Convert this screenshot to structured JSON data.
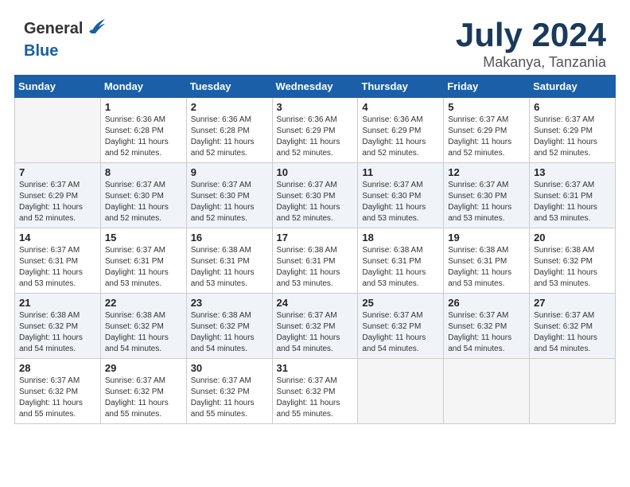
{
  "header": {
    "logo_general": "General",
    "logo_blue": "Blue",
    "title": "July 2024",
    "location": "Makanya, Tanzania"
  },
  "weekdays": [
    "Sunday",
    "Monday",
    "Tuesday",
    "Wednesday",
    "Thursday",
    "Friday",
    "Saturday"
  ],
  "days": [
    {
      "num": "",
      "sunrise": "",
      "sunset": "",
      "daylight": "",
      "empty": true
    },
    {
      "num": "1",
      "sunrise": "Sunrise: 6:36 AM",
      "sunset": "Sunset: 6:28 PM",
      "daylight": "Daylight: 11 hours and 52 minutes."
    },
    {
      "num": "2",
      "sunrise": "Sunrise: 6:36 AM",
      "sunset": "Sunset: 6:28 PM",
      "daylight": "Daylight: 11 hours and 52 minutes."
    },
    {
      "num": "3",
      "sunrise": "Sunrise: 6:36 AM",
      "sunset": "Sunset: 6:29 PM",
      "daylight": "Daylight: 11 hours and 52 minutes."
    },
    {
      "num": "4",
      "sunrise": "Sunrise: 6:36 AM",
      "sunset": "Sunset: 6:29 PM",
      "daylight": "Daylight: 11 hours and 52 minutes."
    },
    {
      "num": "5",
      "sunrise": "Sunrise: 6:37 AM",
      "sunset": "Sunset: 6:29 PM",
      "daylight": "Daylight: 11 hours and 52 minutes."
    },
    {
      "num": "6",
      "sunrise": "Sunrise: 6:37 AM",
      "sunset": "Sunset: 6:29 PM",
      "daylight": "Daylight: 11 hours and 52 minutes."
    },
    {
      "num": "7",
      "sunrise": "Sunrise: 6:37 AM",
      "sunset": "Sunset: 6:29 PM",
      "daylight": "Daylight: 11 hours and 52 minutes."
    },
    {
      "num": "8",
      "sunrise": "Sunrise: 6:37 AM",
      "sunset": "Sunset: 6:30 PM",
      "daylight": "Daylight: 11 hours and 52 minutes."
    },
    {
      "num": "9",
      "sunrise": "Sunrise: 6:37 AM",
      "sunset": "Sunset: 6:30 PM",
      "daylight": "Daylight: 11 hours and 52 minutes."
    },
    {
      "num": "10",
      "sunrise": "Sunrise: 6:37 AM",
      "sunset": "Sunset: 6:30 PM",
      "daylight": "Daylight: 11 hours and 52 minutes."
    },
    {
      "num": "11",
      "sunrise": "Sunrise: 6:37 AM",
      "sunset": "Sunset: 6:30 PM",
      "daylight": "Daylight: 11 hours and 53 minutes."
    },
    {
      "num": "12",
      "sunrise": "Sunrise: 6:37 AM",
      "sunset": "Sunset: 6:30 PM",
      "daylight": "Daylight: 11 hours and 53 minutes."
    },
    {
      "num": "13",
      "sunrise": "Sunrise: 6:37 AM",
      "sunset": "Sunset: 6:31 PM",
      "daylight": "Daylight: 11 hours and 53 minutes."
    },
    {
      "num": "14",
      "sunrise": "Sunrise: 6:37 AM",
      "sunset": "Sunset: 6:31 PM",
      "daylight": "Daylight: 11 hours and 53 minutes."
    },
    {
      "num": "15",
      "sunrise": "Sunrise: 6:37 AM",
      "sunset": "Sunset: 6:31 PM",
      "daylight": "Daylight: 11 hours and 53 minutes."
    },
    {
      "num": "16",
      "sunrise": "Sunrise: 6:38 AM",
      "sunset": "Sunset: 6:31 PM",
      "daylight": "Daylight: 11 hours and 53 minutes."
    },
    {
      "num": "17",
      "sunrise": "Sunrise: 6:38 AM",
      "sunset": "Sunset: 6:31 PM",
      "daylight": "Daylight: 11 hours and 53 minutes."
    },
    {
      "num": "18",
      "sunrise": "Sunrise: 6:38 AM",
      "sunset": "Sunset: 6:31 PM",
      "daylight": "Daylight: 11 hours and 53 minutes."
    },
    {
      "num": "19",
      "sunrise": "Sunrise: 6:38 AM",
      "sunset": "Sunset: 6:31 PM",
      "daylight": "Daylight: 11 hours and 53 minutes."
    },
    {
      "num": "20",
      "sunrise": "Sunrise: 6:38 AM",
      "sunset": "Sunset: 6:32 PM",
      "daylight": "Daylight: 11 hours and 53 minutes."
    },
    {
      "num": "21",
      "sunrise": "Sunrise: 6:38 AM",
      "sunset": "Sunset: 6:32 PM",
      "daylight": "Daylight: 11 hours and 54 minutes."
    },
    {
      "num": "22",
      "sunrise": "Sunrise: 6:38 AM",
      "sunset": "Sunset: 6:32 PM",
      "daylight": "Daylight: 11 hours and 54 minutes."
    },
    {
      "num": "23",
      "sunrise": "Sunrise: 6:38 AM",
      "sunset": "Sunset: 6:32 PM",
      "daylight": "Daylight: 11 hours and 54 minutes."
    },
    {
      "num": "24",
      "sunrise": "Sunrise: 6:37 AM",
      "sunset": "Sunset: 6:32 PM",
      "daylight": "Daylight: 11 hours and 54 minutes."
    },
    {
      "num": "25",
      "sunrise": "Sunrise: 6:37 AM",
      "sunset": "Sunset: 6:32 PM",
      "daylight": "Daylight: 11 hours and 54 minutes."
    },
    {
      "num": "26",
      "sunrise": "Sunrise: 6:37 AM",
      "sunset": "Sunset: 6:32 PM",
      "daylight": "Daylight: 11 hours and 54 minutes."
    },
    {
      "num": "27",
      "sunrise": "Sunrise: 6:37 AM",
      "sunset": "Sunset: 6:32 PM",
      "daylight": "Daylight: 11 hours and 54 minutes."
    },
    {
      "num": "28",
      "sunrise": "Sunrise: 6:37 AM",
      "sunset": "Sunset: 6:32 PM",
      "daylight": "Daylight: 11 hours and 55 minutes."
    },
    {
      "num": "29",
      "sunrise": "Sunrise: 6:37 AM",
      "sunset": "Sunset: 6:32 PM",
      "daylight": "Daylight: 11 hours and 55 minutes."
    },
    {
      "num": "30",
      "sunrise": "Sunrise: 6:37 AM",
      "sunset": "Sunset: 6:32 PM",
      "daylight": "Daylight: 11 hours and 55 minutes."
    },
    {
      "num": "31",
      "sunrise": "Sunrise: 6:37 AM",
      "sunset": "Sunset: 6:32 PM",
      "daylight": "Daylight: 11 hours and 55 minutes."
    },
    {
      "num": "",
      "sunrise": "",
      "sunset": "",
      "daylight": "",
      "empty": true
    },
    {
      "num": "",
      "sunrise": "",
      "sunset": "",
      "daylight": "",
      "empty": true
    },
    {
      "num": "",
      "sunrise": "",
      "sunset": "",
      "daylight": "",
      "empty": true
    }
  ]
}
